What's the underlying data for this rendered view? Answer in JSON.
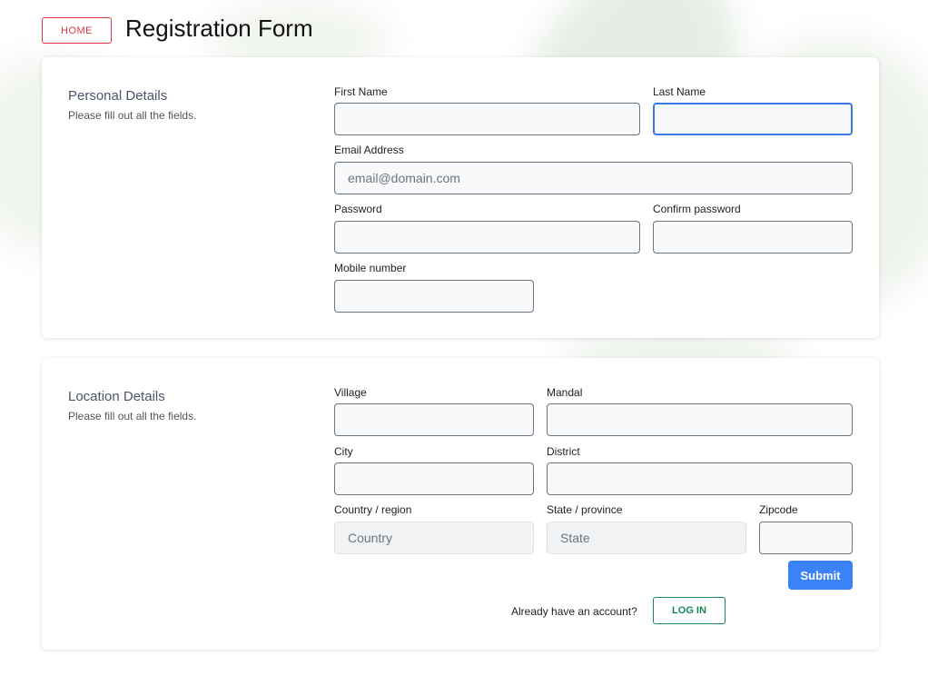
{
  "header": {
    "home_label": "HOME",
    "title": "Registration Form"
  },
  "personal": {
    "title": "Personal Details",
    "subtitle": "Please fill out all the fields.",
    "first_name_label": "First Name",
    "last_name_label": "Last Name",
    "email_label": "Email Address",
    "email_placeholder": "email@domain.com",
    "password_label": "Password",
    "confirm_password_label": "Confirm password",
    "mobile_label": "Mobile number"
  },
  "location": {
    "title": "Location Details",
    "subtitle": "Please fill out all the fields.",
    "village_label": "Village",
    "mandal_label": "Mandal",
    "city_label": "City",
    "district_label": "District",
    "country_label": "Country / region",
    "country_placeholder": "Country",
    "state_label": "State / province",
    "state_placeholder": "State",
    "zipcode_label": "Zipcode"
  },
  "actions": {
    "submit_label": "Submit",
    "already_text": "Already have an account?",
    "login_label": "LOG IN"
  },
  "colors": {
    "home_red": "#dc3545",
    "submit_blue": "#3b82f6",
    "login_green": "#198754",
    "focus_blue": "#3b78e7"
  }
}
